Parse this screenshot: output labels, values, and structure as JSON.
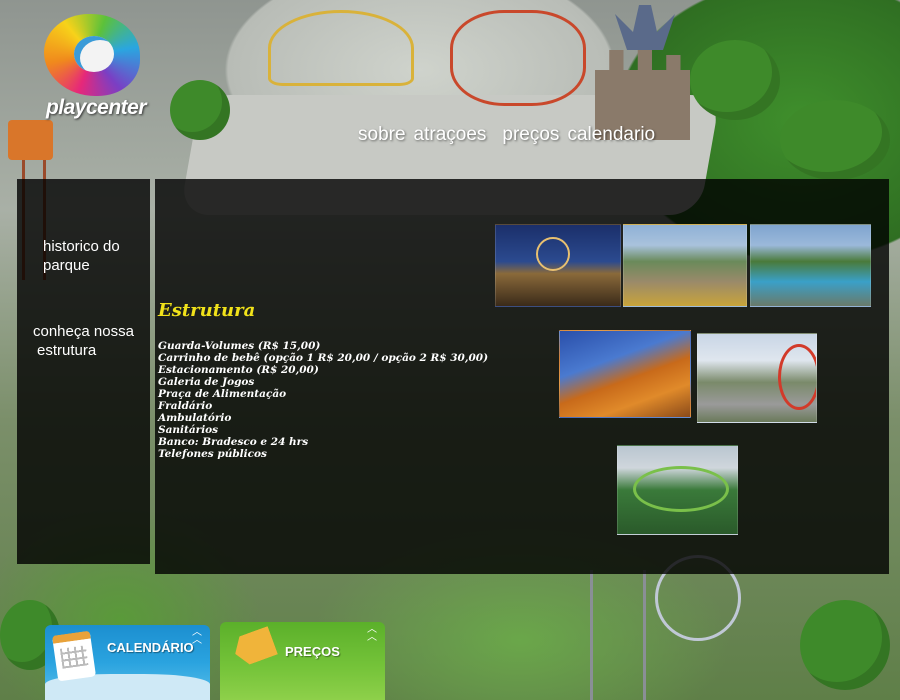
{
  "logo": {
    "text": "playcenter"
  },
  "topnav": [
    "sobre",
    "atraçoes",
    "preços",
    "calendario"
  ],
  "sidebar": {
    "items": [
      {
        "line1": "historico do",
        "line2": "parque"
      },
      {
        "line1": "conheça nossa",
        "line2": "estrutura"
      }
    ]
  },
  "main": {
    "title": "Estrutura",
    "amenities": [
      "Guarda-Volumes (R$ 15,00)",
      "Carrinho de bebê (opção 1 R$ 20,00 / opção 2 R$ 30,00)",
      "Estacionamento (R$ 20,00)",
      "Galeria de Jogos",
      "Praça de Alimentação",
      "Fraldário",
      "Ambulatório",
      "Sanitários",
      "Banco: Bradesco e 24 hrs",
      "Telefones públicos"
    ]
  },
  "bottom": {
    "calendar_label": "CALENDÁRIO",
    "prices_label": "PREÇOS"
  },
  "colors": {
    "title": "#f1e21a",
    "panel": "rgba(0,0,0,0.80)"
  }
}
